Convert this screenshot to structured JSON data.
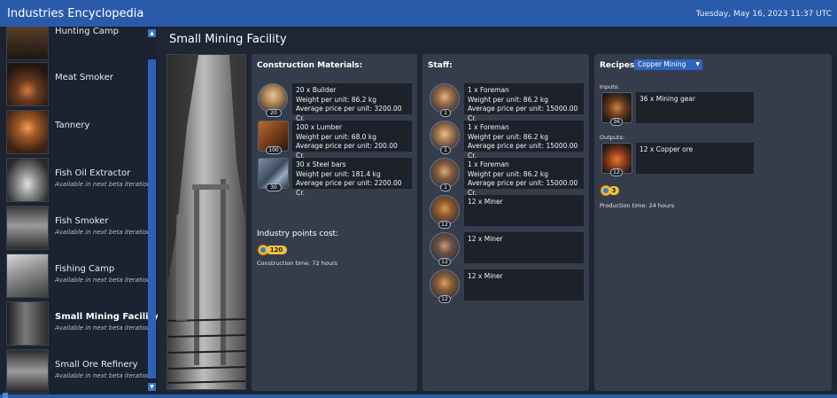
{
  "app": {
    "title": "Industries Encyclopedia",
    "datetime": "Tuesday, May 16, 2023 11:37 UTC"
  },
  "sidebar": {
    "items": [
      {
        "label": "Hunting Camp",
        "sub": ""
      },
      {
        "label": "Meat Smoker",
        "sub": ""
      },
      {
        "label": "Tannery",
        "sub": ""
      },
      {
        "label": "Fish Oil Extractor",
        "sub": "Available in next beta iteration"
      },
      {
        "label": "Fish Smoker",
        "sub": "Available in next beta iteration"
      },
      {
        "label": "Fishing Camp",
        "sub": "Available in next beta iteration"
      },
      {
        "label": "Small Mining Facility",
        "sub": "Available in next beta iteration"
      },
      {
        "label": "Small Ore Refinery",
        "sub": "Available in next beta iteration"
      }
    ],
    "selected": "Small Mining Facility"
  },
  "main": {
    "title": "Small Mining Facility",
    "construction": {
      "heading": "Construction Materials:",
      "items": [
        {
          "badge": "20",
          "line1": "20 x Builder",
          "line2": "Weight per unit: 86.2 kg",
          "line3": "Average price per unit: 3200.00 Cr."
        },
        {
          "badge": "100",
          "line1": "100 x Lumber",
          "line2": "Weight per unit: 68.0 kg",
          "line3": "Average price per unit: 200.00 Cr."
        },
        {
          "badge": "30",
          "line1": "30 x Steel bars",
          "line2": "Weight per unit: 181.4 kg",
          "line3": "Average price per unit: 2200.00 Cr."
        }
      ],
      "points_label": "Industry points cost:",
      "points_value": "120",
      "time": "Construction time: 72 hours"
    },
    "staff": {
      "heading": "Staff:",
      "items": [
        {
          "badge": "1",
          "line1": "1 x Foreman",
          "line2": "Weight per unit: 86.2 kg",
          "line3": "Average price per unit: 15000.00 Cr."
        },
        {
          "badge": "1",
          "line1": "1 x Foreman",
          "line2": "Weight per unit: 86.2 kg",
          "line3": "Average price per unit: 15000.00 Cr."
        },
        {
          "badge": "1",
          "line1": "1 x Foreman",
          "line2": "Weight per unit: 86.2 kg",
          "line3": "Average price per unit: 15000.00 Cr."
        },
        {
          "badge": "12",
          "line1": "12 x Miner",
          "line2": "",
          "line3": ""
        },
        {
          "badge": "12",
          "line1": "12 x Miner",
          "line2": "",
          "line3": ""
        },
        {
          "badge": "12",
          "line1": "12 x Miner",
          "line2": "",
          "line3": ""
        }
      ]
    },
    "recipes": {
      "heading": "Recipes:",
      "selected": "Copper Mining",
      "inputs_label": "Inputs:",
      "input": {
        "badge": "36",
        "label": "36 x Mining gear"
      },
      "outputs_label": "Outputs:",
      "output": {
        "badge": "12",
        "label": "12 x Copper ore"
      },
      "points_value": "3",
      "time": "Production time: 24 hours"
    }
  },
  "colors": {
    "titlebar": "#2a5bab",
    "panel": "#353d4c",
    "accent": "#2f64bb",
    "coin": "#f3c23a"
  }
}
